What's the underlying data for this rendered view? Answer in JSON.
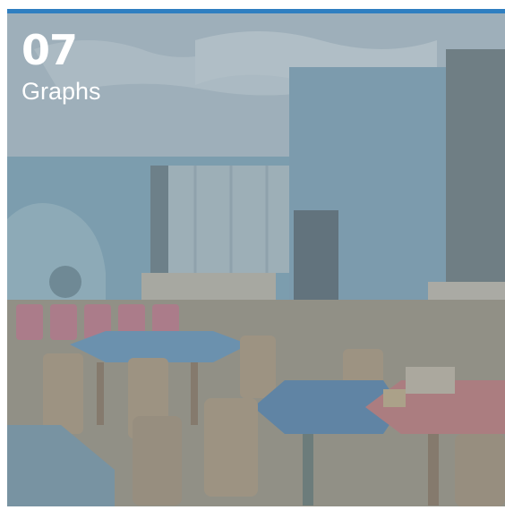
{
  "card": {
    "number": "07",
    "title": "Graphs",
    "accent_color": "#2f7fc1",
    "background_image": "classroom-photo"
  }
}
